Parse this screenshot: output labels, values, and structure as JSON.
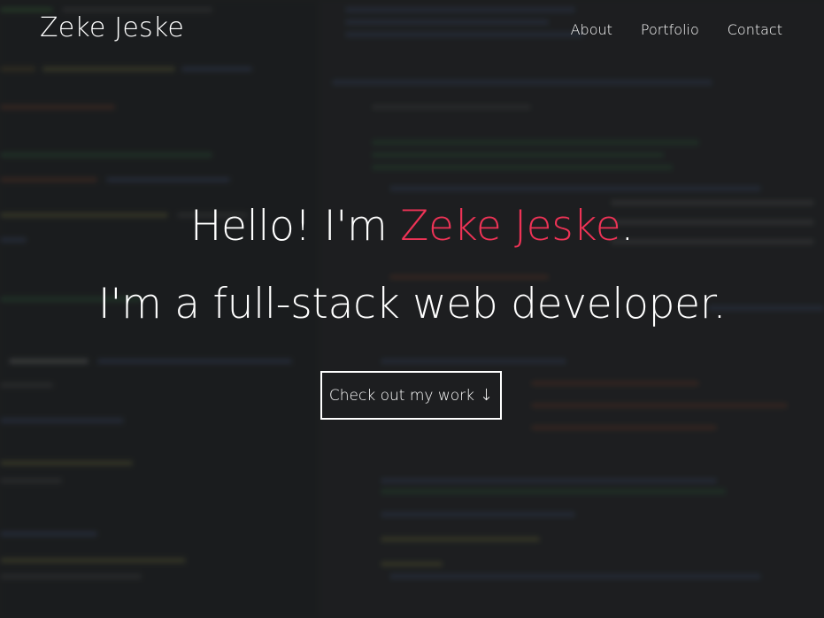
{
  "brand": {
    "name": "Zeke Jeske"
  },
  "nav": {
    "items": [
      {
        "label": "About"
      },
      {
        "label": "Portfolio"
      },
      {
        "label": "Contact"
      }
    ]
  },
  "hero": {
    "greeting_prefix": "Hello! I'm ",
    "greeting_name": "Zeke Jeske",
    "greeting_suffix": ".",
    "subtitle": "I'm a full-stack web developer.",
    "cta_label": "Check out my work",
    "cta_icon": "arrow-down-icon"
  },
  "colors": {
    "accent": "#ee3356",
    "text": "#ffffff",
    "background": "#232425"
  }
}
